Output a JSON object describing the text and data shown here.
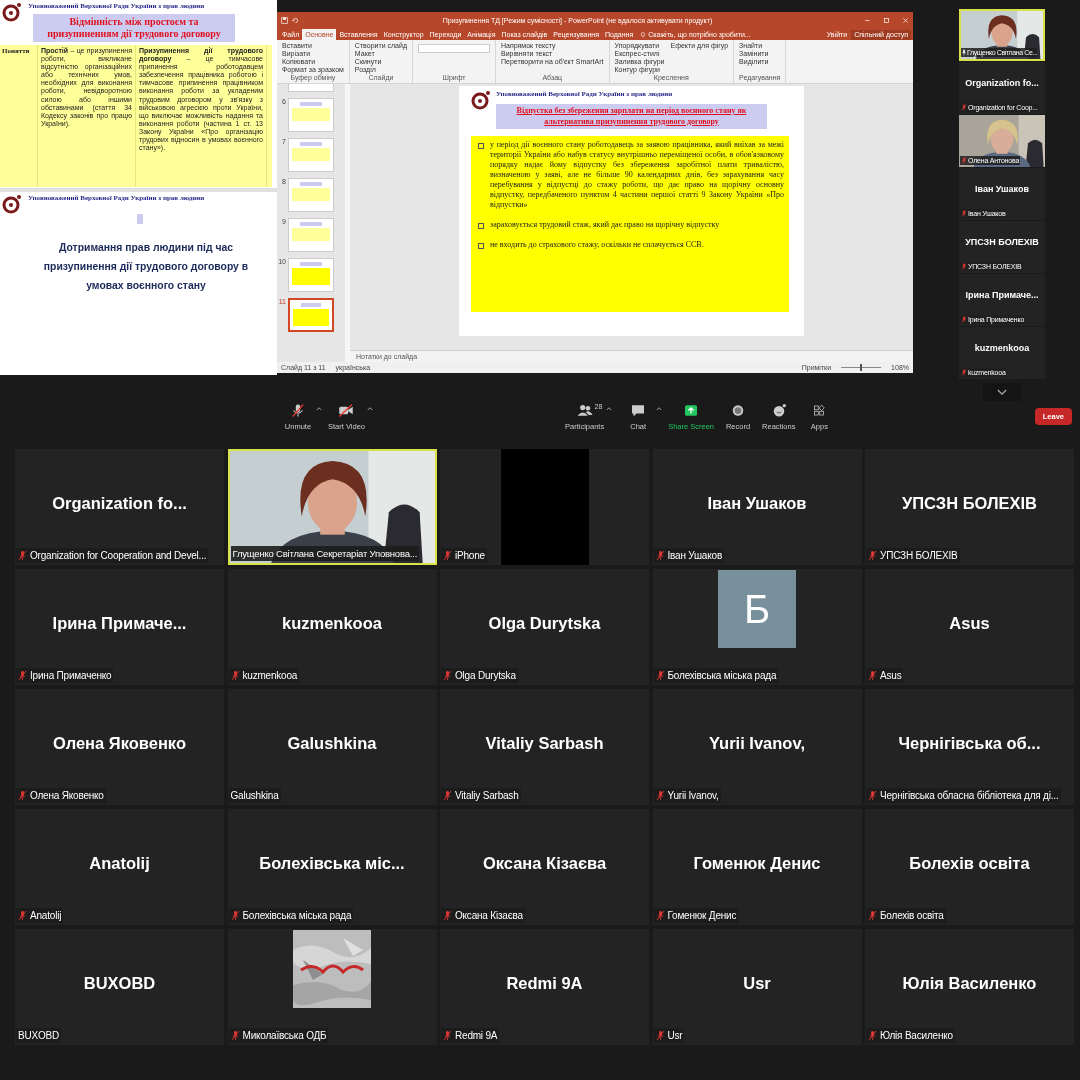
{
  "shared_slides": [
    {
      "kind": "table",
      "header": "Уповноважений Верховної Ради України з прав людини",
      "title": "Відмінність між простоєм та призупиненням дії трудового договору",
      "table": {
        "label": "Поняття",
        "cells": [
          "**Простій** – це призупинення роботи, викликане відсутністю організаційних або технічних умов, необхідних для виконання роботи, невідворотною силою або іншими обставинами (стаття 34 Кодексу законів про працю України).",
          "**Призупинення дії трудового договору** – це тимчасове припинення роботодавцем забезпечення працівника роботою і тимчасове припинення працівником виконання роботи за укладеним трудовим договором у зв'язку з військовою агресією проти України, що виключає можливість надання та виконання роботи (частина 1 ст. 13 Закону України «Про організацію трудових відносин в умовах воєнного стану»)."
        ]
      }
    },
    {
      "kind": "title",
      "header": "Уповноважений Верховної Ради України з прав людини",
      "title": "Дотримання прав людини під час призупинення дії трудового договору в умовах воєнного стану"
    }
  ],
  "powerpoint": {
    "title": "Призупинення ТД [Режим сумісності] - PowerPoint (не вдалося активувати продукт)",
    "tabs": [
      {
        "label": "Файл",
        "selected": false
      },
      {
        "label": "Основне",
        "selected": true
      },
      {
        "label": "Вставлення",
        "selected": false
      },
      {
        "label": "Конструктор",
        "selected": false
      },
      {
        "label": "Переходи",
        "selected": false
      },
      {
        "label": "Анімація",
        "selected": false
      },
      {
        "label": "Показ слайдів",
        "selected": false
      },
      {
        "label": "Рецензування",
        "selected": false
      },
      {
        "label": "Подання",
        "selected": false
      }
    ],
    "tell_me": "Скажіть, що потрібно зробити...",
    "sign_in": "Увійти",
    "share": "Спільний доступ",
    "ribbon": [
      {
        "label": "Буфер обміну",
        "items": [
          "Вставити",
          "Вирізати",
          "Копіювати",
          "Формат за зразком"
        ]
      },
      {
        "label": "Слайди",
        "items": [
          "Створити слайд",
          "Макет",
          "Скинути",
          "Розділ"
        ]
      },
      {
        "label": "Шрифт"
      },
      {
        "label": "Абзац",
        "items": [
          "Напрямок тексту",
          "Вирівняти текст",
          "Перетворити на об'єкт SmartArt"
        ]
      },
      {
        "label": "Креслення",
        "items": [
          "Упорядкувати",
          "Експрес-стилі",
          "Заливка фігури",
          "Контур фігури",
          "Ефекти для фігур"
        ]
      },
      {
        "label": "Редагування",
        "items": [
          "Знайти",
          "Замінити",
          "Виділити"
        ]
      }
    ],
    "thumbnails": [
      {
        "kind": "table",
        "selected": false
      },
      {
        "number": "6",
        "kind": "table",
        "selected": false
      },
      {
        "number": "7",
        "kind": "table",
        "selected": false
      },
      {
        "number": "8",
        "kind": "table",
        "selected": false
      },
      {
        "number": "9",
        "kind": "table",
        "selected": false
      },
      {
        "number": "10",
        "kind": "bullets",
        "selected": false
      },
      {
        "number": "11",
        "kind": "bullets",
        "selected": true
      }
    ],
    "slide": {
      "header": "Уповноважений Верховної Ради України з прав людини",
      "title": "Відпустка без збереження зарплати на період воєнного стану як альтернатива призупинення трудового договору",
      "bullets": [
        "у період дії воєнного стану роботодавець за заявою працівника, який виїхав за межі території України або набув статусу внутрішньо переміщеної особи, в обов'язковому порядку надає йому відпустку без збереження заробітної плати тривалістю, визначеною у заяві, але не більше 90 календарних днів, без зарахування часу перебування у відпустці до стажу роботи, що дає право на щорічну основну відпустку, передбаченого пунктом 4 частини першої статті 9 Закону України «Про відпустки»",
        "зараховується трудовий стаж, який дає право на щорічну відпустку",
        "не входить до страхового стажу, оскільки не сплачується ССВ."
      ]
    },
    "notes": "Нотатки до слайда",
    "status": {
      "slide": "Слайд 11 з 11",
      "language": "українська",
      "comments": "Примітки",
      "zoom_slider": {
        "level": 0.5
      },
      "zoom": "108%"
    }
  },
  "sidebar": {
    "tiles": [
      {
        "kind": "video",
        "name": "Глущенко Світлана Се...",
        "muted": false,
        "speaking": true
      },
      {
        "kind": "name",
        "display": "Organization  fo...",
        "name": "Organization for Coop...",
        "muted": true,
        "speaking": false
      },
      {
        "kind": "video",
        "name": "Олена Антонова",
        "muted": true,
        "speaking": false
      },
      {
        "kind": "name",
        "display": "Іван Ушаков",
        "name": "Іван Ушаков",
        "muted": true,
        "speaking": false
      },
      {
        "kind": "name",
        "display": "УПСЗН БОЛЕХІВ",
        "name": "УПСЗН БОЛЕХІВ",
        "muted": true,
        "speaking": false
      },
      {
        "kind": "name",
        "display": "Ірина  Примаче...",
        "name": "Ірина Примаченко",
        "muted": true,
        "speaking": false
      },
      {
        "kind": "name",
        "display": "kuzmenkooa",
        "name": "kuzmenkooa",
        "muted": true,
        "speaking": false
      }
    ]
  },
  "toolbar": {
    "buttons": [
      {
        "kind": "mic",
        "label": "Unmute",
        "menu": true
      },
      {
        "kind": "video",
        "label": "Start Video",
        "menu": true
      },
      {
        "kind": "participants",
        "label": "Participants",
        "count": "28",
        "menu": true
      },
      {
        "kind": "chat",
        "label": "Chat",
        "menu": true
      },
      {
        "kind": "share",
        "label": "Share Screen",
        "menu": false
      },
      {
        "kind": "record",
        "label": "Record",
        "menu": false
      },
      {
        "kind": "reactions",
        "label": "Reactions",
        "menu": false
      },
      {
        "kind": "apps",
        "label": "Apps",
        "menu": false
      }
    ],
    "leave": "Leave"
  },
  "grid": {
    "tiles": [
      {
        "kind": "name",
        "display": "Organization  fo...",
        "name": "Organization for Cooperation and Devel...",
        "muted": true,
        "speaking": false
      },
      {
        "kind": "video",
        "name": "Глущенко Світлана Секретаріат Уповнова...",
        "muted": false,
        "speaking": true
      },
      {
        "kind": "blank",
        "name": "iPhone",
        "muted": true,
        "speaking": false
      },
      {
        "kind": "name",
        "display": "Іван Ушаков",
        "name": "Іван Ушаков",
        "muted": true,
        "speaking": false
      },
      {
        "kind": "name",
        "display": "УПСЗН БОЛЕХІВ",
        "name": "УПСЗН БОЛЕХІВ",
        "muted": true,
        "speaking": false
      },
      {
        "kind": "name",
        "display": "Ірина  Примаче...",
        "name": "Ірина Примаченко",
        "muted": true,
        "speaking": false
      },
      {
        "kind": "name",
        "display": "kuzmenkooa",
        "name": "kuzmenkooa",
        "muted": true,
        "speaking": false
      },
      {
        "kind": "name",
        "display": "Olga Durytska",
        "name": "Olga Durytska",
        "muted": true,
        "speaking": false
      },
      {
        "kind": "avatar",
        "letter": "Б",
        "color": "#78909c",
        "name": "Болехівська міська рада",
        "muted": true,
        "speaking": false
      },
      {
        "kind": "name",
        "display": "Asus",
        "name": "Asus",
        "muted": true,
        "speaking": false
      },
      {
        "kind": "name",
        "display": "Олена Яковенко",
        "name": "Олена Яковенко",
        "muted": true,
        "speaking": false
      },
      {
        "kind": "name",
        "display": "Galushkina",
        "name": "Galushkina",
        "muted": false,
        "speaking": false
      },
      {
        "kind": "name",
        "display": "Vitaliy Sarbash",
        "name": "Vitaliy Sarbash",
        "muted": true,
        "speaking": false
      },
      {
        "kind": "name",
        "display": "Yurii Ivanov,",
        "name": "Yurii Ivanov,",
        "muted": true,
        "speaking": false
      },
      {
        "kind": "name",
        "display": "Чернігівська об...",
        "name": "Чернігівська обласна бібліотека для ді...",
        "muted": true,
        "speaking": false
      },
      {
        "kind": "name",
        "display": "Anatolij",
        "name": "Anatolij",
        "muted": true,
        "speaking": false
      },
      {
        "kind": "name",
        "display": "Болехівська міс...",
        "name": "Болехівська міська рада",
        "muted": true,
        "speaking": false
      },
      {
        "kind": "name",
        "display": "Оксана Кізаєва",
        "name": "Оксана Кізаєва",
        "muted": true,
        "speaking": false
      },
      {
        "kind": "name",
        "display": "Гоменюк Денис",
        "name": "Гоменюк Денис",
        "muted": true,
        "speaking": false
      },
      {
        "kind": "name",
        "display": "Болехів освіта",
        "name": "Болехів освіта",
        "muted": true,
        "speaking": false
      },
      {
        "kind": "name",
        "display": "BUXOBD",
        "name": "BUXOBD",
        "muted": false,
        "speaking": false
      },
      {
        "kind": "picture",
        "name": "Миколаївська ОДБ",
        "muted": true,
        "speaking": false
      },
      {
        "kind": "name",
        "display": "Redmi 9A",
        "name": "Redmi 9A",
        "muted": true,
        "speaking": false
      },
      {
        "kind": "name",
        "display": "Usr",
        "name": "Usr",
        "muted": true,
        "speaking": false
      },
      {
        "kind": "name",
        "display": "Юлія Василенко",
        "name": "Юлія Василенко",
        "muted": true,
        "speaking": false
      }
    ]
  }
}
